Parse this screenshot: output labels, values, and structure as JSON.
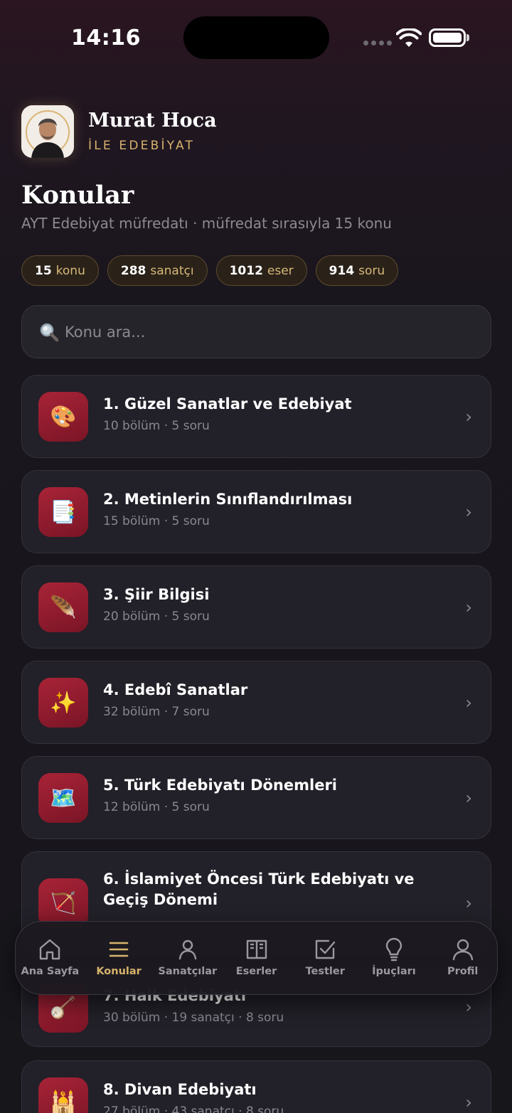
{
  "status_bar": {
    "time": "14:16"
  },
  "brand": {
    "title": "Murat Hoca",
    "subtitle": "İLE EDEBİYAT"
  },
  "page": {
    "title": "Konular",
    "description": "AYT Edebiyat müfredatı · müfredat sırasıyla 15 konu"
  },
  "stats": [
    {
      "value": "15",
      "label": "konu"
    },
    {
      "value": "288",
      "label": "sanatçı"
    },
    {
      "value": "1012",
      "label": "eser"
    },
    {
      "value": "914",
      "label": "soru"
    }
  ],
  "search": {
    "placeholder": "Konu ara..."
  },
  "topics": [
    {
      "title": "1. Güzel Sanatlar ve Edebiyat",
      "meta": "10 bölüm · 5 soru",
      "icon": "🎨",
      "icon_name": "palette-icon"
    },
    {
      "title": "2. Metinlerin Sınıflandırılması",
      "meta": "15 bölüm · 5 soru",
      "icon": "📑",
      "icon_name": "document-icon"
    },
    {
      "title": "3. Şiir Bilgisi",
      "meta": "20 bölüm · 5 soru",
      "icon": "🪶",
      "icon_name": "feather-icon"
    },
    {
      "title": "4. Edebî Sanatlar",
      "meta": "32 bölüm · 7 soru",
      "icon": "✨",
      "icon_name": "sparkles-icon"
    },
    {
      "title": "5. Türk Edebiyatı Dönemleri",
      "meta": "12 bölüm · 5 soru",
      "icon": "🗺️",
      "icon_name": "map-icon"
    },
    {
      "title": "6. İslamiyet Öncesi Türk Edebiyatı ve Geçiş Dönemi",
      "meta": "",
      "icon": "🏹",
      "icon_name": "bow-arrow-icon"
    },
    {
      "title": "7. Halk Edebiyatı",
      "meta": "30 bölüm · 19 sanatçı · 8 soru",
      "icon": "🪕",
      "icon_name": "banjo-icon"
    },
    {
      "title": "8. Divan Edebiyatı",
      "meta": "27 bölüm · 43 sanatçı · 8 soru",
      "icon": "🕌",
      "icon_name": "mosque-icon"
    }
  ],
  "nav": [
    {
      "label": "Ana Sayfa",
      "icon": "home-icon",
      "active": false
    },
    {
      "label": "Konular",
      "icon": "menu-icon",
      "active": true
    },
    {
      "label": "Sanatçılar",
      "icon": "person-icon",
      "active": false
    },
    {
      "label": "Eserler",
      "icon": "book-icon",
      "active": false
    },
    {
      "label": "Testler",
      "icon": "checkbox-icon",
      "active": false
    },
    {
      "label": "İpuçları",
      "icon": "lightbulb-icon",
      "active": false
    },
    {
      "label": "Profil",
      "icon": "profile-icon",
      "active": false
    }
  ],
  "colors": {
    "accent": "#d7b36c",
    "icon_bg": "#a82337",
    "card_bg": "#222028"
  }
}
